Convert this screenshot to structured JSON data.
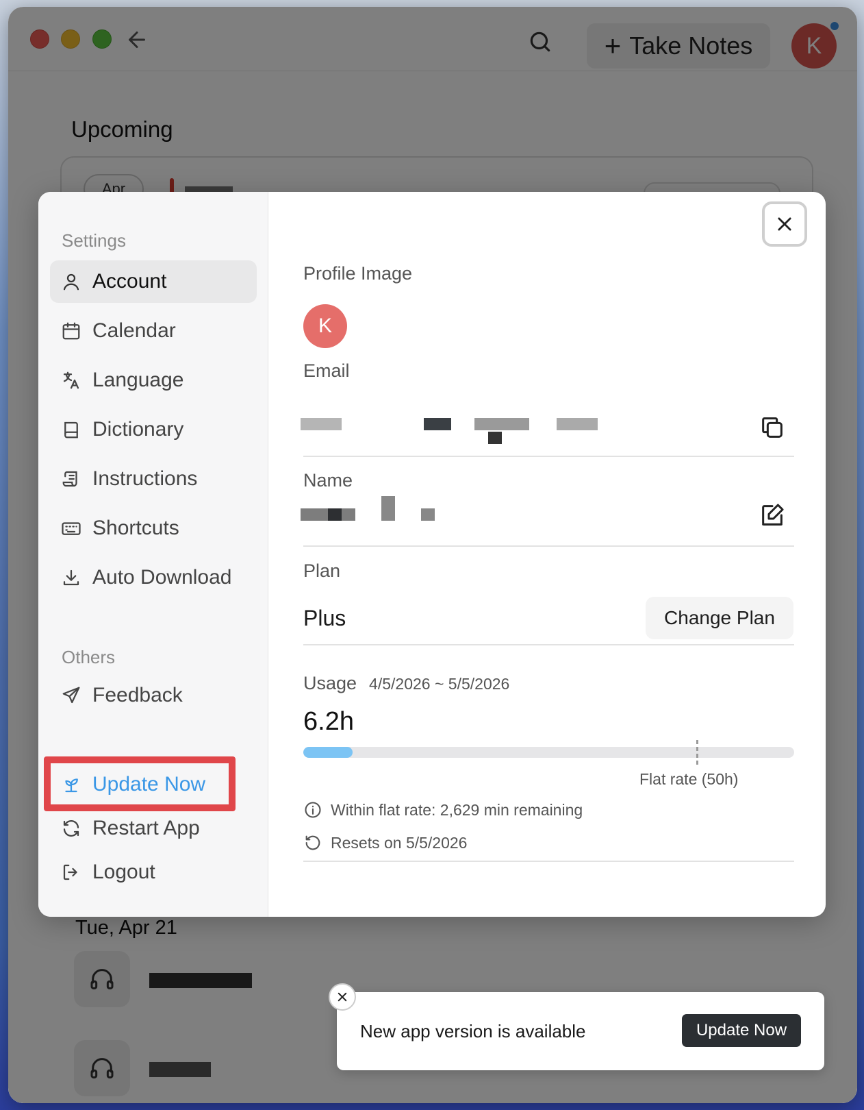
{
  "titlebar": {
    "take_notes_label": "Take Notes",
    "avatar_initial": "K"
  },
  "background": {
    "upcoming_title": "Upcoming",
    "apr_pill": "Apr",
    "date_header": "Tue, Apr 21"
  },
  "settings": {
    "section_settings": "Settings",
    "items": [
      {
        "label": "Account",
        "icon": "user-icon"
      },
      {
        "label": "Calendar",
        "icon": "calendar-icon"
      },
      {
        "label": "Language",
        "icon": "translate-icon"
      },
      {
        "label": "Dictionary",
        "icon": "book-icon"
      },
      {
        "label": "Instructions",
        "icon": "scroll-icon"
      },
      {
        "label": "Shortcuts",
        "icon": "keyboard-icon"
      },
      {
        "label": "Auto Download",
        "icon": "download-icon"
      }
    ],
    "section_others": "Others",
    "others": [
      {
        "label": "Feedback",
        "icon": "send-icon"
      },
      {
        "label": "Update Now",
        "icon": "sprout-icon"
      },
      {
        "label": "Restart App",
        "icon": "refresh-icon"
      },
      {
        "label": "Logout",
        "icon": "logout-icon"
      }
    ]
  },
  "account": {
    "profile_image_label": "Profile Image",
    "profile_initial": "K",
    "email_label": "Email",
    "name_label": "Name",
    "plan_label": "Plan",
    "plan_value": "Plus",
    "change_plan_label": "Change Plan",
    "usage_label": "Usage",
    "usage_range": "4/5/2026 ~ 5/5/2026",
    "usage_value": "6.2h",
    "usage_fill_fraction": 0.1,
    "flat_rate_fraction": 0.8,
    "flat_rate_label": "Flat rate (50h)",
    "remaining_text": "Within flat rate: 2,629 min remaining",
    "resets_text": "Resets on 5/5/2026"
  },
  "toast": {
    "message": "New app version is available",
    "button_label": "Update Now"
  },
  "colors": {
    "accent_blue": "#3a97e6",
    "highlight_red": "#e0464a",
    "avatar_red": "#d9554f",
    "usage_fill": "#7cc4f4"
  }
}
